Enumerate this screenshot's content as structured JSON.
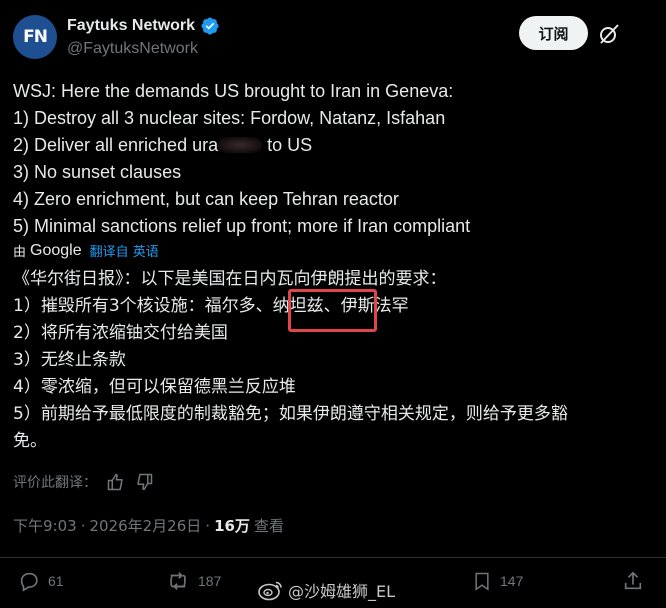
{
  "author": {
    "name": "Faytuks Network",
    "handle": "@FaytuksNetwork",
    "avatar_text": "FN"
  },
  "header": {
    "subscribe_label": "订阅"
  },
  "tweet": {
    "lines": [
      "WSJ: Here the demands US brought to Iran in Geneva:",
      "1) Destroy all 3 nuclear sites: Fordow, Natanz, Isfahan",
      "2) Deliver all enriched ura",
      "to US",
      "3) No sunset clauses",
      "4) Zero enrichment, but can keep Tehran reactor",
      "5) Minimal sanctions relief up front; more if Iran compliant"
    ]
  },
  "translation": {
    "by_label": "由",
    "provider": "Google",
    "link_label": "翻译自 英语",
    "lines": [
      "《华尔街日报》：以下是美国在日内瓦向伊朗提出的要求：",
      "1）摧毁所有3个核设施：福尔多、纳坦兹、伊斯法罕",
      "2）将所有浓缩铀交付给美国",
      "3）无终止条款",
      "4）零浓缩，但可以保留德黑兰反应堆",
      "5）前期给予最低限度的制裁豁免；如果伊朗遵守相关规定，则给予更多豁",
      "免。"
    ],
    "rate_label": "评价此翻译："
  },
  "meta": {
    "time": "下午9:03",
    "date": "2026年2月26日",
    "views_count": "16万",
    "views_label": "查看"
  },
  "actions": {
    "replies": "61",
    "reposts": "187",
    "bookmarks": "147"
  },
  "watermark": {
    "text": "@沙姆雄狮_EL"
  },
  "colors": {
    "background": "#000000",
    "text": "#e7e9ea",
    "muted": "#71767b",
    "link": "#1d9bf0",
    "verified": "#1d9bf0",
    "highlight": "#e0454a"
  }
}
